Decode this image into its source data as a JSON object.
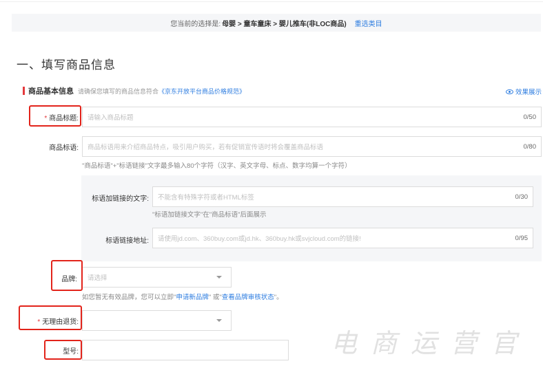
{
  "selection": {
    "prefix": "您当前的选择是:",
    "path": "母婴 > 童车童床 > 婴儿推车(非LOC商品)",
    "reselect": "重选类目"
  },
  "section_title": "一、填写商品信息",
  "basic_info": {
    "title": "商品基本信息",
    "hint": "请确保您填写的商品信息符合",
    "hint_link": "《京东开放平台商品价格规范》",
    "preview": "效果展示"
  },
  "fields": {
    "product_title": {
      "required_mark": "*",
      "label": "商品标题:",
      "placeholder": "请输入商品标题",
      "count": "0/50"
    },
    "slogan": {
      "label": "商品标语:",
      "placeholder": "商品标语用来介绍商品特点，吸引用户购买，若有促销宣传语时将会覆盖商品标语",
      "count": "0/80",
      "note": "\"商品标语\"+\"标语链接\"文字最多输入80个字符（汉字、英文字母、标点、数字均算一个字符）"
    },
    "slogan_link_text": {
      "label": "标语加链接的文字:",
      "placeholder": "不能含有特殊字符或者HTML标签",
      "count": "0/30",
      "note": "\"标语加链接文字\"在\"商品标语\"后面展示"
    },
    "slogan_link_url": {
      "label": "标语链接地址:",
      "placeholder": "请使用jd.com、360buy.com或jd.hk、360buy.hk或svjcloud.com的链接!",
      "count": "0/95"
    },
    "brand": {
      "label": "品牌:",
      "placeholder": "请选择",
      "note_prefix": "如您暂无有效品牌，您可以立即\"",
      "note_link1": "申请新品牌",
      "note_mid": "\" 或\"",
      "note_link2": "查看品牌审核状态",
      "note_suffix": "\"。"
    },
    "no_reason_return": {
      "required_mark": "*",
      "label": "无理由退货:",
      "placeholder": ""
    },
    "model": {
      "label": "型号:",
      "value": ""
    }
  },
  "watermark": "电商运营官",
  "colors": {
    "accent_blue": "#2e7de0",
    "required_red": "#e4393c",
    "highlight_box": "#e2231a"
  }
}
